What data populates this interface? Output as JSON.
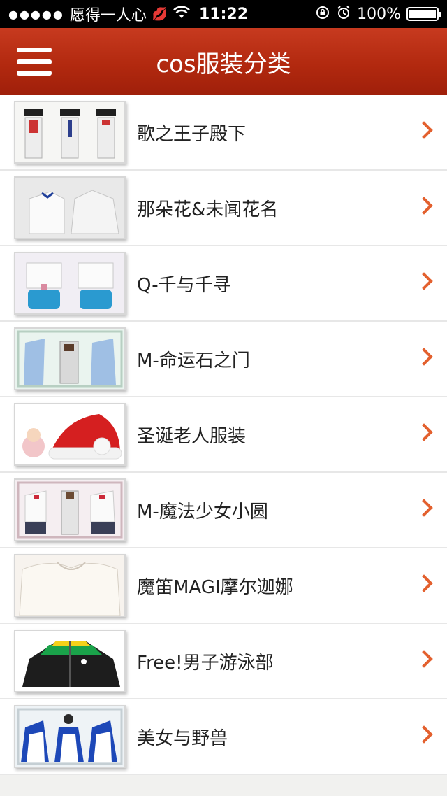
{
  "status_bar": {
    "carrier": "愿得一人心",
    "time": "11:22",
    "battery_label": "100%",
    "signal_dots": "●●●●●",
    "icons": [
      "lips-icon",
      "wifi-icon",
      "rotation-lock-icon",
      "alarm-icon",
      "battery-icon"
    ]
  },
  "header": {
    "title": "cos服装分类",
    "menu_icon": "hamburger-menu-icon"
  },
  "categories": [
    {
      "label": "歌之王子殿下"
    },
    {
      "label": "那朵花&未闻花名"
    },
    {
      "label": "Q-千与千寻"
    },
    {
      "label": "M-命运石之门"
    },
    {
      "label": "圣诞老人服装"
    },
    {
      "label": "M-魔法少女小圆"
    },
    {
      "label": "魔笛MAGI摩尔迦娜"
    },
    {
      "label": "Free!男子游泳部"
    },
    {
      "label": "美女与野兽"
    }
  ],
  "colors": {
    "nav_bar": "#b2290f",
    "chevron": "#e3602e"
  }
}
